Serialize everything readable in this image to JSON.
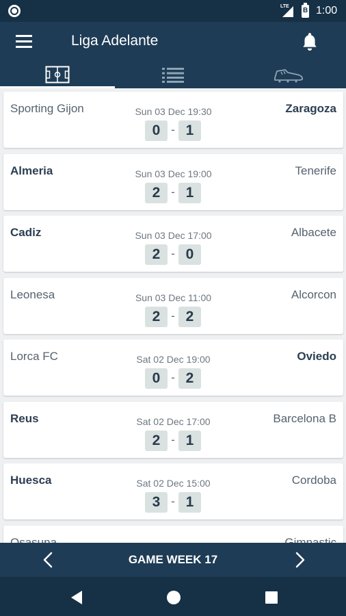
{
  "status": {
    "network": "LTE",
    "battery": "B",
    "time": "1:00"
  },
  "header": {
    "title": "Liga Adelante",
    "menu_icon": "menu-icon",
    "bell_icon": "bell-icon"
  },
  "tabs": [
    {
      "icon": "pitch-icon",
      "selected": true
    },
    {
      "icon": "list-icon",
      "selected": false
    },
    {
      "icon": "boot-icon",
      "selected": false
    }
  ],
  "matches": [
    {
      "home": "Sporting Gijon",
      "away": "Zaragoza",
      "datetime": "Sun 03 Dec 19:30",
      "home_score": "0",
      "away_score": "1",
      "separator": "-",
      "winner": "away"
    },
    {
      "home": "Almeria",
      "away": "Tenerife",
      "datetime": "Sun 03 Dec 19:00",
      "home_score": "2",
      "away_score": "1",
      "separator": "-",
      "winner": "home"
    },
    {
      "home": "Cadiz",
      "away": "Albacete",
      "datetime": "Sun 03 Dec 17:00",
      "home_score": "2",
      "away_score": "0",
      "separator": "-",
      "winner": "home"
    },
    {
      "home": "Leonesa",
      "away": "Alcorcon",
      "datetime": "Sun 03 Dec 11:00",
      "home_score": "2",
      "away_score": "2",
      "separator": "-",
      "winner": "none"
    },
    {
      "home": "Lorca FC",
      "away": "Oviedo",
      "datetime": "Sat 02 Dec 19:00",
      "home_score": "0",
      "away_score": "2",
      "separator": "-",
      "winner": "away"
    },
    {
      "home": "Reus",
      "away": "Barcelona B",
      "datetime": "Sat 02 Dec 17:00",
      "home_score": "2",
      "away_score": "1",
      "separator": "-",
      "winner": "home"
    },
    {
      "home": "Huesca",
      "away": "Cordoba",
      "datetime": "Sat 02 Dec 15:00",
      "home_score": "3",
      "away_score": "1",
      "separator": "-",
      "winner": "home"
    },
    {
      "home": "Osasuna",
      "away": "Gimnastic",
      "datetime": "",
      "home_score": "",
      "away_score": "",
      "separator": "",
      "winner": "none"
    }
  ],
  "week_nav": {
    "label": "GAME WEEK 17",
    "prev_icon": "chevron-left-icon",
    "next_icon": "chevron-right-icon"
  },
  "system_nav": {
    "back_icon": "back-icon",
    "home_icon": "home-icon",
    "recents_icon": "recents-icon"
  },
  "colors": {
    "primary": "#1e3c55",
    "status": "#163045",
    "score_bg": "#d9e2e1",
    "background": "#eef0f2"
  }
}
